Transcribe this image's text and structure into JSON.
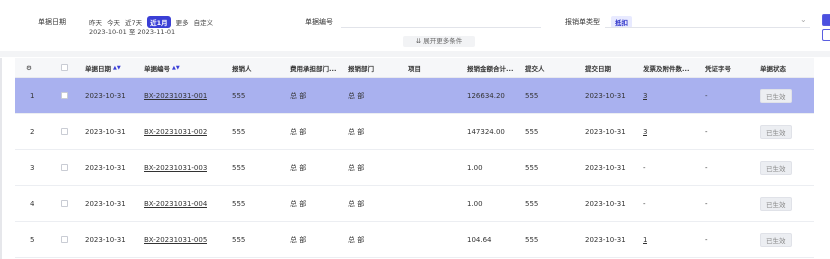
{
  "filters": {
    "date_label": "单据日期",
    "date_chips": [
      "昨天",
      "今天",
      "近7天",
      "近1月",
      "更多",
      "自定义"
    ],
    "date_range": "2023-10-01 至 2023-11-01",
    "doc_no_label": "单据编号",
    "doc_no_value": "",
    "type_label": "报销单类型",
    "type_tag": "抵扣",
    "more_conditions": "展开更多条件"
  },
  "table": {
    "columns": [
      "单据日期",
      "单据编号",
      "报销人",
      "费用承担部门...",
      "报销部门",
      "项目",
      "报销金额合计...",
      "提交人",
      "提交日期",
      "发票及附件数...",
      "凭证字号",
      "单据状态"
    ],
    "rows": [
      {
        "no": "1",
        "date": "2023-10-31",
        "doc": "BX-20231031-001",
        "person": "555",
        "cost_dept": "总 部",
        "dept": "总 部",
        "project": "",
        "amount": "126634.20",
        "submitter": "555",
        "submit_date": "2023-10-31",
        "invoices": "3",
        "voucher": "-",
        "status": "已生效"
      },
      {
        "no": "2",
        "date": "2023-10-31",
        "doc": "BX-20231031-002",
        "person": "555",
        "cost_dept": "总 部",
        "dept": "总 部",
        "project": "",
        "amount": "147324.00",
        "submitter": "555",
        "submit_date": "2023-10-31",
        "invoices": "3",
        "voucher": "-",
        "status": "已生效"
      },
      {
        "no": "3",
        "date": "2023-10-31",
        "doc": "BX-20231031-003",
        "person": "555",
        "cost_dept": "总 部",
        "dept": "总 部",
        "project": "",
        "amount": "1.00",
        "submitter": "555",
        "submit_date": "2023-10-31",
        "invoices": "-",
        "voucher": "-",
        "status": "已生效"
      },
      {
        "no": "4",
        "date": "2023-10-31",
        "doc": "BX-20231031-004",
        "person": "555",
        "cost_dept": "总 部",
        "dept": "总 部",
        "project": "",
        "amount": "1.00",
        "submitter": "555",
        "submit_date": "2023-10-31",
        "invoices": "-",
        "voucher": "-",
        "status": "已生效"
      },
      {
        "no": "5",
        "date": "2023-10-31",
        "doc": "BX-20231031-005",
        "person": "555",
        "cost_dept": "总 部",
        "dept": "总 部",
        "project": "",
        "amount": "104.64",
        "submitter": "555",
        "submit_date": "2023-10-31",
        "invoices": "1",
        "voucher": "-",
        "status": "已生效"
      }
    ],
    "selected_row": 0
  },
  "icons": {
    "settings": "gear-icon",
    "sort": "sort-icon",
    "expand": "chevron-down-icon"
  },
  "colors": {
    "accent": "#3a3fd6",
    "selected_row": "#a9b1ef",
    "tag_bg": "#e8eaff"
  }
}
